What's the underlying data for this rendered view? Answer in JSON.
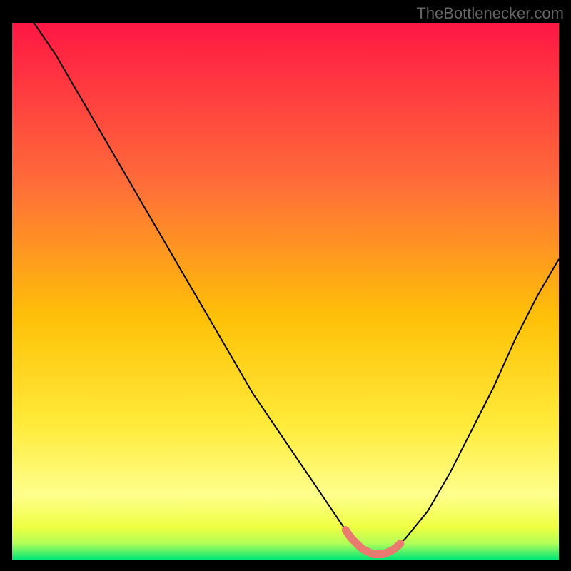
{
  "watermark": "TheBottlenecker.com",
  "chart_data": {
    "type": "line",
    "title": "",
    "xlabel": "",
    "ylabel": "",
    "xlim": [
      0,
      100
    ],
    "ylim": [
      0,
      100
    ],
    "x": [
      0,
      4,
      8,
      12,
      16,
      20,
      24,
      28,
      32,
      36,
      40,
      44,
      48,
      52,
      56,
      60,
      62,
      64,
      66,
      68,
      70,
      72,
      76,
      80,
      84,
      88,
      92,
      96,
      100
    ],
    "y": [
      105,
      100,
      94,
      87,
      80,
      73,
      66,
      59,
      52,
      45,
      38,
      31,
      25,
      19,
      13,
      7,
      4,
      2,
      1,
      1,
      2,
      4,
      9,
      16,
      24,
      32,
      41,
      49,
      56
    ],
    "highlight": {
      "x_start": 61,
      "x_end": 71,
      "color": "#e87a6f"
    },
    "gradient_colors": {
      "top": "#ff1744",
      "upper_mid": "#ff9100",
      "mid": "#ffea00",
      "lower_mid": "#eeff41",
      "bottom": "#00e676"
    }
  }
}
